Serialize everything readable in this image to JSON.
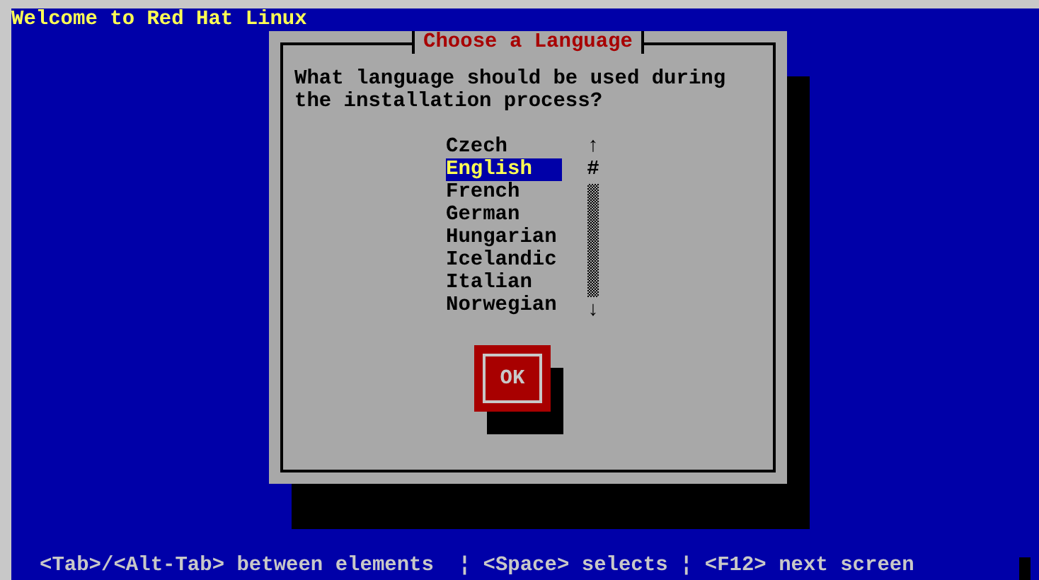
{
  "screen_title": "Welcome to Red Hat Linux",
  "dialog": {
    "title": "Choose a Language",
    "prompt": "What language should be used during the installation process?",
    "languages": [
      {
        "label": "Czech",
        "selected": false
      },
      {
        "label": "English",
        "selected": true
      },
      {
        "label": "French",
        "selected": false
      },
      {
        "label": "German",
        "selected": false
      },
      {
        "label": "Hungarian",
        "selected": false
      },
      {
        "label": "Icelandic",
        "selected": false
      },
      {
        "label": "Italian",
        "selected": false
      },
      {
        "label": "Norwegian",
        "selected": false
      }
    ],
    "scrollbar": {
      "up": "↑",
      "thumb": "#",
      "down": "↓"
    },
    "ok_button": "OK"
  },
  "help_bar": "<Tab>/<Alt-Tab> between elements  ¦ <Space> selects ¦ <F12> next screen"
}
